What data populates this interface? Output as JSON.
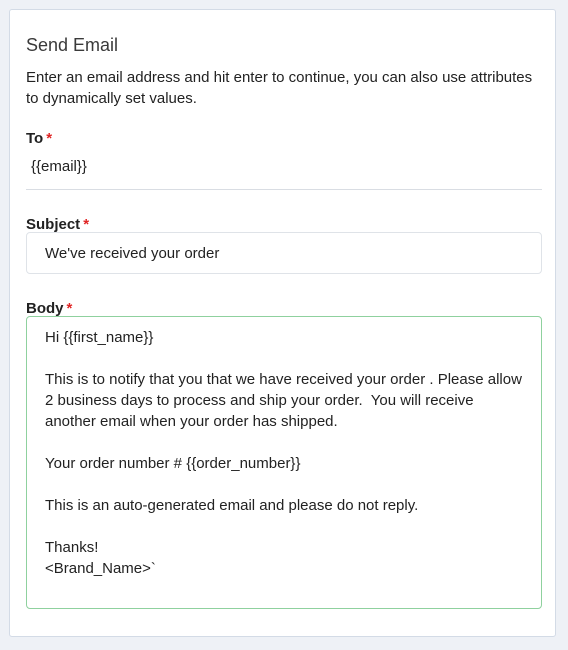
{
  "form": {
    "title": "Send Email",
    "description": "Enter an email address and hit enter to continue, you can also use attributes to dynamically set values.",
    "required_marker": "*",
    "to": {
      "label": "To",
      "value": "{{email}}"
    },
    "subject": {
      "label": "Subject",
      "value": "We've received your order"
    },
    "body": {
      "label": "Body",
      "value": "Hi {{first_name}}\n\nThis is to notify that you that we have received your order . Please allow 2 business days to process and ship your order.  You will receive another email when your order has shipped.\n\nYour order number # {{order_number}}\n\nThis is an auto-generated email and please do not reply.\n\nThanks!\n<Brand_Name>`"
    }
  },
  "colors": {
    "required": "#e02424",
    "focus_border": "#8fd19e",
    "background": "#eef1f6"
  }
}
